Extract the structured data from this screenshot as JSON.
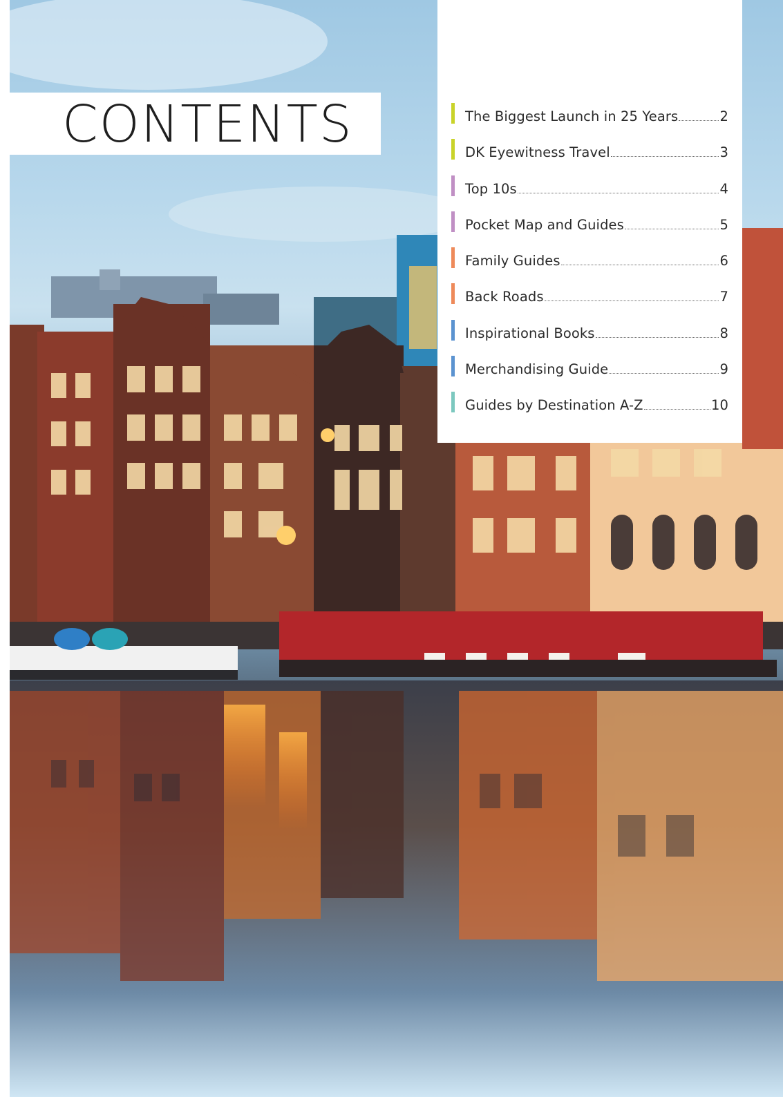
{
  "title": "CONTENTS",
  "contents": [
    {
      "label": "The Biggest Launch in 25 Years",
      "page": "2",
      "color": "#c9d32a"
    },
    {
      "label": "DK Eyewitness Travel",
      "page": "3",
      "color": "#c9d32a"
    },
    {
      "label": "Top 10s",
      "page": "4",
      "color": "#c08fc4"
    },
    {
      "label": "Pocket Map and Guides",
      "page": "5",
      "color": "#c08fc4"
    },
    {
      "label": "Family Guides",
      "page": "6",
      "color": "#ee8a5a"
    },
    {
      "label": "Back Roads",
      "page": "7",
      "color": "#ee8a5a"
    },
    {
      "label": "Inspirational Books",
      "page": "8",
      "color": "#5b93d0"
    },
    {
      "label": "Merchandising Guide",
      "page": "9",
      "color": "#5b93d0"
    },
    {
      "label": "Guides by Destination A-Z",
      "page": "10",
      "color": "#7cc8bf"
    }
  ]
}
